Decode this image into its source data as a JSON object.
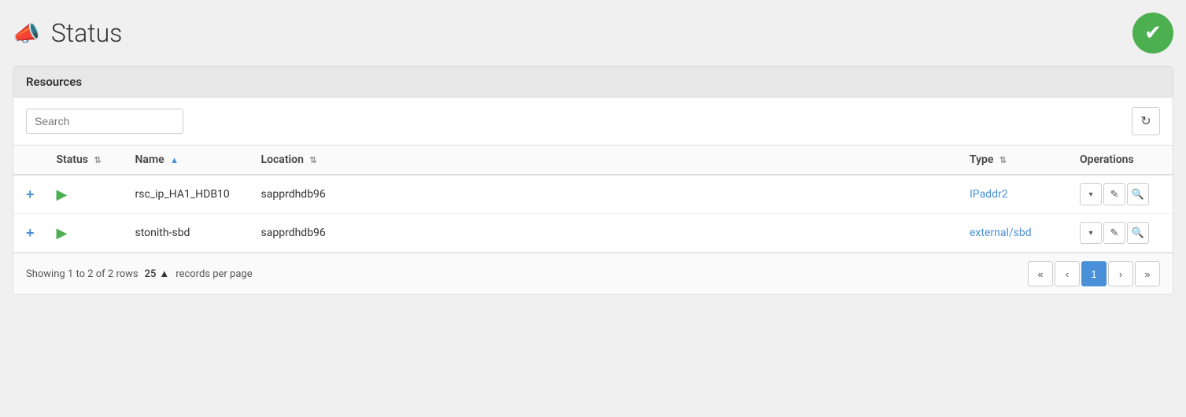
{
  "header": {
    "title": "Status",
    "megaphone": "📣",
    "check_icon": "✔"
  },
  "card": {
    "header_title": "Resources"
  },
  "toolbar": {
    "search_placeholder": "Search",
    "refresh_icon": "↻"
  },
  "table": {
    "columns": [
      {
        "id": "expand",
        "label": ""
      },
      {
        "id": "status",
        "label": "Status",
        "sort": "neutral"
      },
      {
        "id": "name",
        "label": "Name",
        "sort": "asc"
      },
      {
        "id": "location",
        "label": "Location",
        "sort": "neutral"
      },
      {
        "id": "type",
        "label": "Type",
        "sort": "neutral"
      },
      {
        "id": "operations",
        "label": "Operations"
      }
    ],
    "rows": [
      {
        "id": "row1",
        "name": "rsc_ip_HA1_HDB10",
        "location": "sapprdhdb96",
        "type": "IPaddr2",
        "type_href": "#"
      },
      {
        "id": "row2",
        "name": "stonith-sbd",
        "location": "sapprdhdb96",
        "type": "external/sbd",
        "type_href": "#"
      }
    ]
  },
  "footer": {
    "showing_text": "Showing 1 to 2 of 2 rows",
    "per_page_value": "25",
    "per_page_label": "records per page",
    "pagination": {
      "first": "«",
      "prev": "‹",
      "current": "1",
      "next": "›",
      "last": "»"
    }
  },
  "ops": {
    "dropdown": "▾",
    "edit": "✎",
    "search": "🔍"
  }
}
